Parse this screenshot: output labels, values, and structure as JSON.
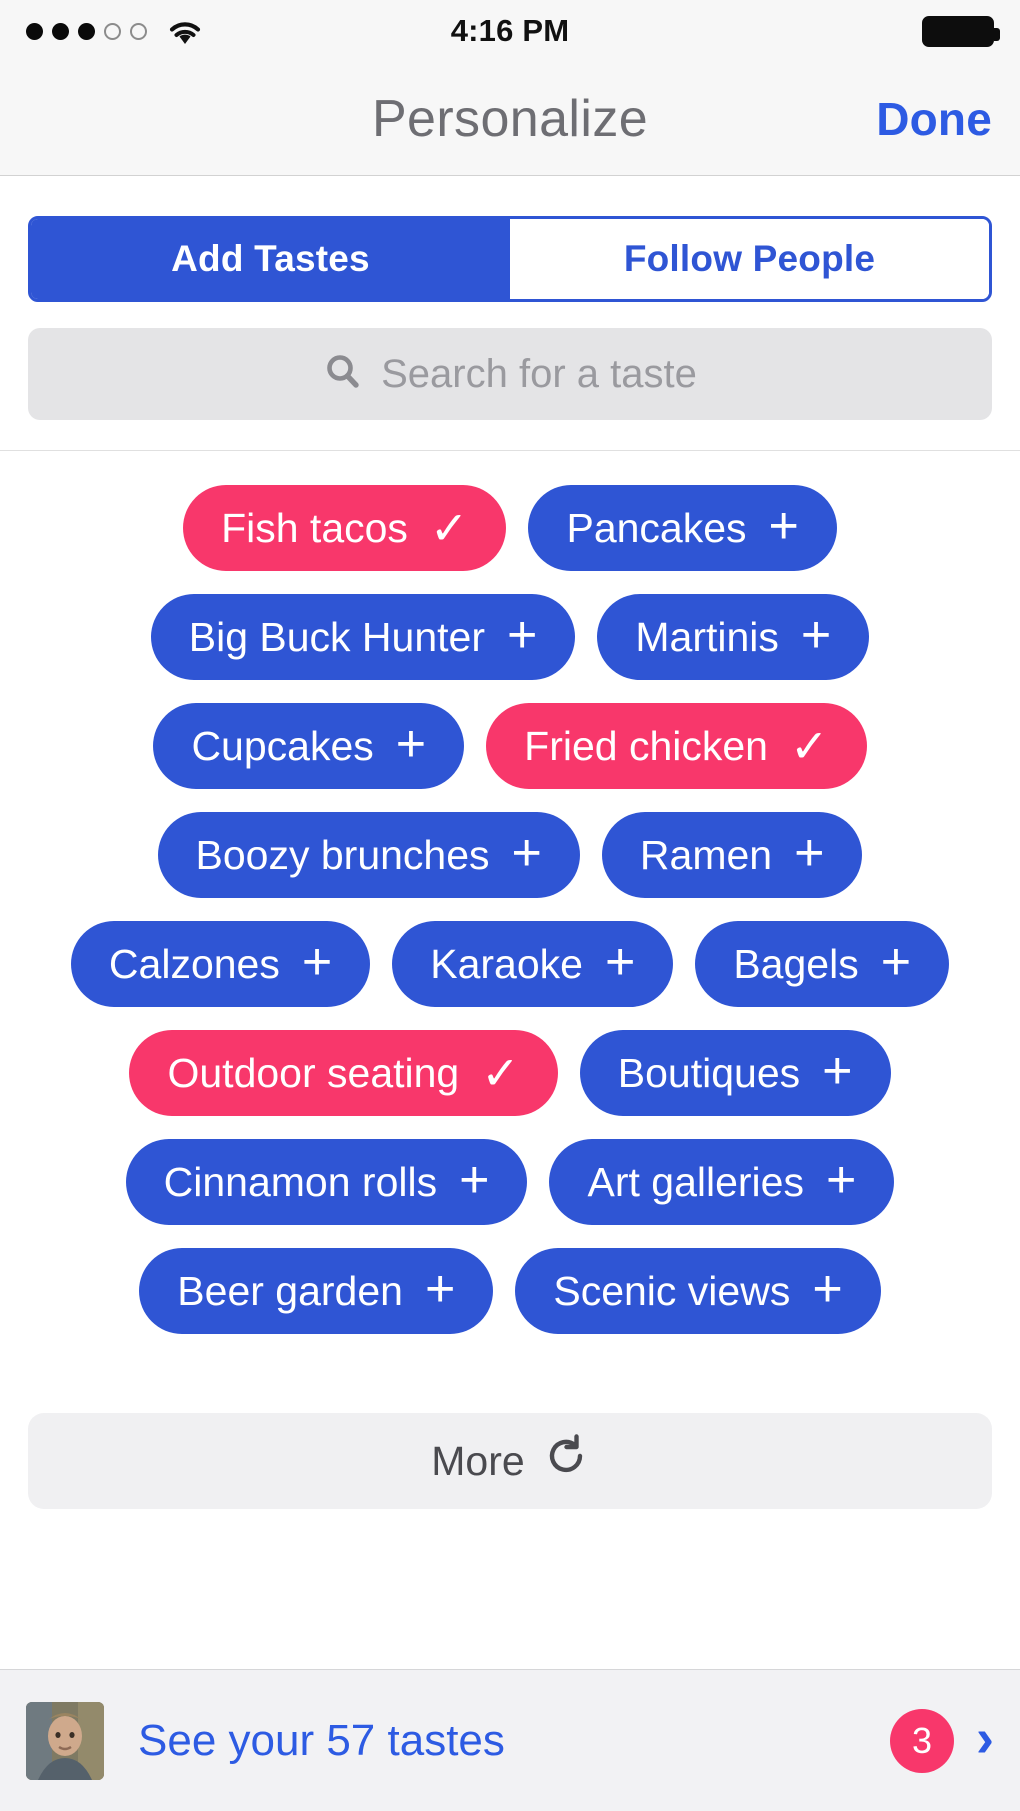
{
  "status_bar": {
    "signal_dots_filled": 3,
    "signal_dots_total": 5,
    "wifi_icon": "wifi-icon",
    "time": "4:16 PM",
    "battery_icon": "battery-full-icon"
  },
  "nav": {
    "title": "Personalize",
    "done_label": "Done"
  },
  "segmented_control": {
    "options": [
      {
        "label": "Add Tastes",
        "active": true
      },
      {
        "label": "Follow People",
        "active": false
      }
    ]
  },
  "search": {
    "placeholder": "Search for a taste",
    "value": "",
    "icon": "search-icon"
  },
  "tags": {
    "rows": [
      [
        {
          "label": "Fish tacos",
          "selected": true,
          "glyph": "✓"
        },
        {
          "label": "Pancakes",
          "selected": false,
          "glyph": "+"
        }
      ],
      [
        {
          "label": "Big Buck Hunter",
          "selected": false,
          "glyph": "+"
        },
        {
          "label": "Martinis",
          "selected": false,
          "glyph": "+"
        }
      ],
      [
        {
          "label": "Cupcakes",
          "selected": false,
          "glyph": "+"
        },
        {
          "label": "Fried chicken",
          "selected": true,
          "glyph": "✓"
        }
      ],
      [
        {
          "label": "Boozy brunches",
          "selected": false,
          "glyph": "+"
        },
        {
          "label": "Ramen",
          "selected": false,
          "glyph": "+"
        }
      ],
      [
        {
          "label": "Calzones",
          "selected": false,
          "glyph": "+"
        },
        {
          "label": "Karaoke",
          "selected": false,
          "glyph": "+"
        },
        {
          "label": "Bagels",
          "selected": false,
          "glyph": "+"
        }
      ],
      [
        {
          "label": "Outdoor seating",
          "selected": true,
          "glyph": "✓"
        },
        {
          "label": "Boutiques",
          "selected": false,
          "glyph": "+"
        }
      ],
      [
        {
          "label": "Cinnamon rolls",
          "selected": false,
          "glyph": "+"
        },
        {
          "label": "Art galleries",
          "selected": false,
          "glyph": "+"
        }
      ],
      [
        {
          "label": "Beer garden",
          "selected": false,
          "glyph": "+"
        },
        {
          "label": "Scenic views",
          "selected": false,
          "glyph": "+"
        }
      ]
    ]
  },
  "more_button": {
    "label": "More",
    "icon": "refresh-icon"
  },
  "bottom_bar": {
    "avatar": "user-avatar-photo",
    "label": "See your 57 tastes",
    "badge_count": "3",
    "chevron": "chevron-right-icon"
  },
  "colors": {
    "accent_blue": "#2F55D4",
    "link_blue": "#2D5BE3",
    "selected_pink": "#F8376B",
    "chrome_gray": "#F7F7F7",
    "search_gray": "#E4E4E6",
    "more_gray": "#F0F0F2",
    "bottom_gray": "#F2F2F4"
  }
}
